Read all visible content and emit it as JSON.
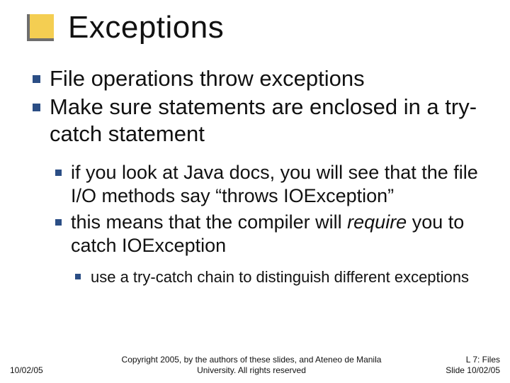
{
  "title": "Exceptions",
  "bullets": {
    "lvl1": [
      "File operations throw exceptions",
      "Make sure statements are enclosed in a try-catch statement"
    ],
    "lvl2": [
      {
        "pre": "if you look at Java docs, you will see that the file I/O methods say “throws IOException”"
      },
      {
        "pre": "this means that the compiler will ",
        "em": "require",
        "post": " you to catch IOException"
      }
    ],
    "lvl3": [
      "use a try-catch chain to distinguish different exceptions"
    ]
  },
  "footer": {
    "date": "10/02/05",
    "copy": "Copyright 2005, by the authors of these slides, and Ateneo de Manila University. All rights reserved",
    "right1": "L 7: Files",
    "right2": "Slide 10/02/05"
  }
}
